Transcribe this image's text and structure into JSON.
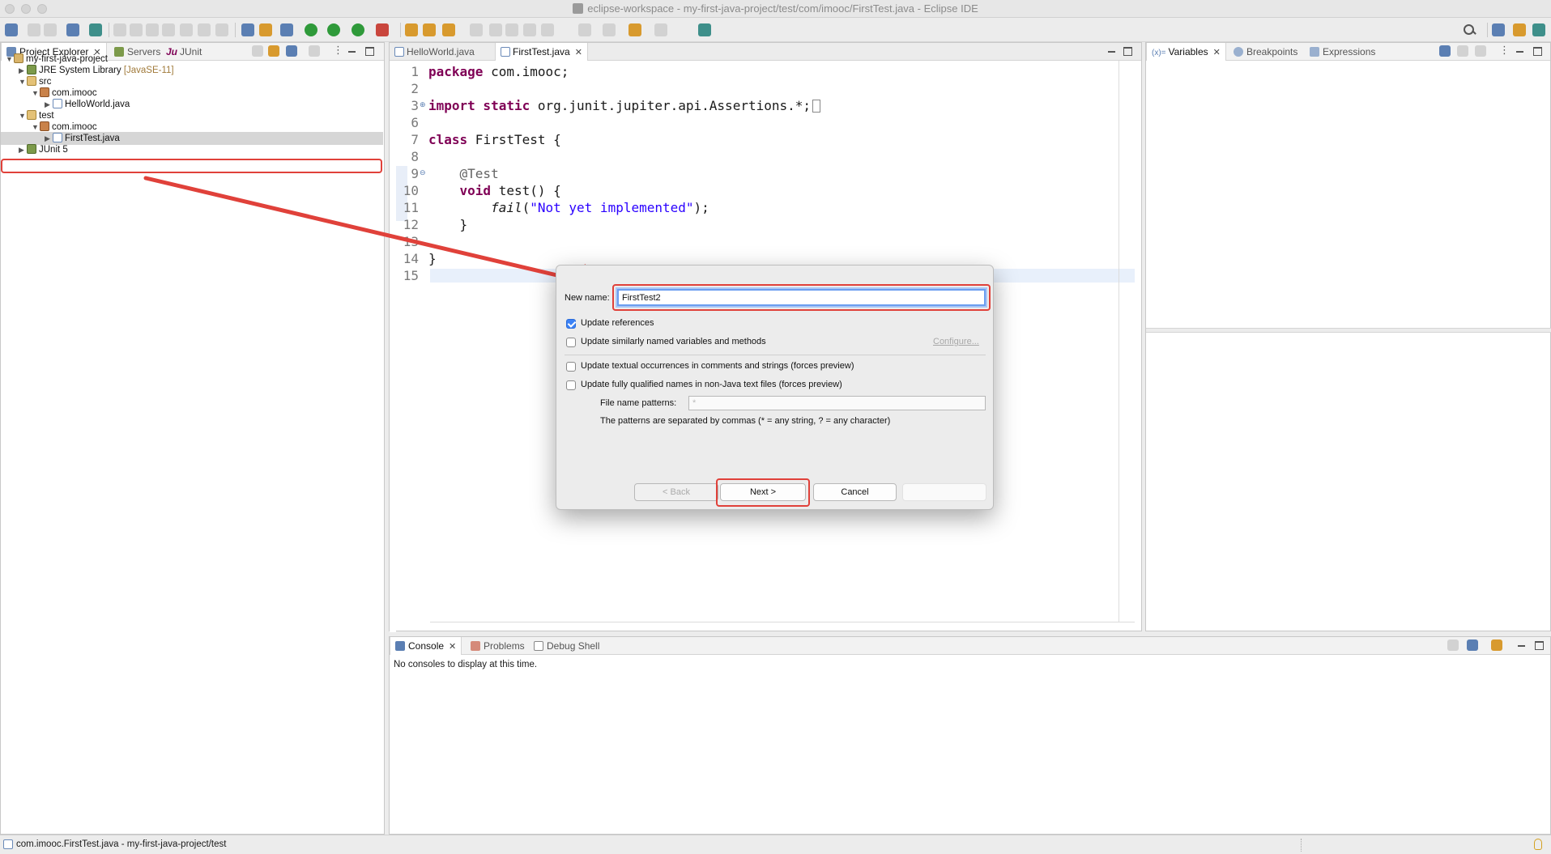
{
  "window": {
    "title": "eclipse-workspace - my-first-java-project/test/com/imooc/FirstTest.java - Eclipse IDE"
  },
  "explorer": {
    "tabs": [
      {
        "label": "Project Explorer",
        "active": true
      },
      {
        "label": "Servers"
      },
      {
        "label": "JUnit",
        "icon_text": "Ju"
      }
    ],
    "tree": [
      {
        "label": "my-first-java-project",
        "icon": "project-icon"
      },
      {
        "label": "JRE System Library",
        "decor": "[JavaSE-11]",
        "icon": "library-icon"
      },
      {
        "label": "src",
        "icon": "source-folder-icon"
      },
      {
        "label": "com.imooc",
        "icon": "package-icon"
      },
      {
        "label": "HelloWorld.java",
        "icon": "java-file-icon"
      },
      {
        "label": "test",
        "icon": "source-folder-icon"
      },
      {
        "label": "com.imooc",
        "icon": "package-icon"
      },
      {
        "label": "FirstTest.java",
        "icon": "java-file-icon",
        "selected": true
      },
      {
        "label": "JUnit 5",
        "icon": "library-icon"
      }
    ]
  },
  "editor": {
    "tabs": [
      {
        "label": "HelloWorld.java"
      },
      {
        "label": "FirstTest.java",
        "active": true
      }
    ],
    "line_numbers": [
      "1",
      "2",
      "3",
      "6",
      "7",
      "8",
      "9",
      "10",
      "11",
      "12",
      "13",
      "14",
      "15"
    ],
    "code": {
      "l1_kw": "package",
      "l1_rest": " com.imooc;",
      "l3_kw": "import static",
      "l3_rest": " org.junit.jupiter.api.Assertions.*;",
      "l7_kw": "class",
      "l7_rest": " FirstTest {",
      "l9_ann": "    @Test",
      "l10_kw": "    void",
      "l10_rest": " test() {",
      "l11_fn": "        fail",
      "l11_open": "(",
      "l11_str": "\"Not yet implemented\"",
      "l11_close": ");",
      "l12": "    }",
      "l14": "}"
    }
  },
  "debug": {
    "tabs": [
      {
        "label": "Variables",
        "icon_text": "(x)=",
        "active": true
      },
      {
        "label": "Breakpoints"
      },
      {
        "label": "Expressions"
      }
    ]
  },
  "console": {
    "tabs": [
      {
        "label": "Console",
        "active": true
      },
      {
        "label": "Problems"
      },
      {
        "label": "Debug Shell"
      }
    ],
    "message": "No consoles to display at this time."
  },
  "dialog": {
    "new_name_label": "New name:",
    "new_name_value": "FirstTest2",
    "options": [
      {
        "label": "Update references",
        "checked": true
      },
      {
        "label": "Update similarly named variables and methods",
        "checked": false
      },
      {
        "label": "Update textual occurrences in comments and strings (forces preview)",
        "checked": false
      },
      {
        "label": "Update fully qualified names in non-Java text files (forces preview)",
        "checked": false
      }
    ],
    "configure_link": "Configure...",
    "file_patterns_label": "File name patterns:",
    "file_patterns_value": "*",
    "patterns_hint": "The patterns are separated by commas (* = any string, ? = any character)",
    "buttons": {
      "back": "< Back",
      "next": "Next >",
      "cancel": "Cancel"
    }
  },
  "status": {
    "text": "com.imooc.FirstTest.java - my-first-java-project/test"
  },
  "colors": {
    "annotation_red": "#e0413a",
    "keyword": "#7f0055",
    "string": "#2a00ff"
  }
}
